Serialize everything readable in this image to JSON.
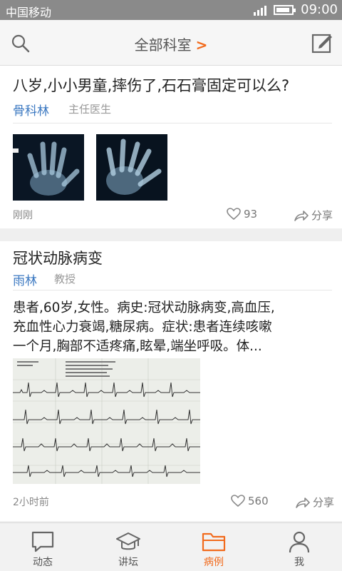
{
  "status_bar": {
    "carrier": "中国移动",
    "time": "09:00"
  },
  "nav": {
    "title": "全部科室",
    "title_chevron": ">",
    "icons": [
      "search-icon",
      "compose-icon"
    ]
  },
  "posts": [
    {
      "title": "八岁,小小男童,摔伤了,石石膏固定可以么?",
      "author": "骨科林",
      "role": "主任医生",
      "images": [
        "hand-xray-image",
        "hand-xray-image"
      ],
      "time": "刚刚",
      "likes": "93",
      "share_label": "分享"
    },
    {
      "title": "冠状动脉病变",
      "author": "雨林",
      "role": "教授",
      "text_lines": [
        "患者,60岁,女性。病史:冠状动脉病变,高血压,",
        "充血性心力衰竭,糖尿病。症状:患者连续咳嗽",
        "一个月,胸部不适疼痛,眩晕,端坐呼吸。体..."
      ],
      "images": [
        "ecg-image"
      ],
      "time": "2小时前",
      "likes": "560",
      "share_label": "分享"
    }
  ],
  "tabs": [
    {
      "label": "动态",
      "icon": "chat-icon",
      "active": false
    },
    {
      "label": "讲坛",
      "icon": "graduation-cap-icon",
      "active": false
    },
    {
      "label": "病例",
      "icon": "folder-icon",
      "active": true
    },
    {
      "label": "我",
      "icon": "person-icon",
      "active": false
    }
  ],
  "colors": {
    "accent": "#f26b1d",
    "author_link": "#3b78c1",
    "status_bar": "#8a8a8a"
  }
}
